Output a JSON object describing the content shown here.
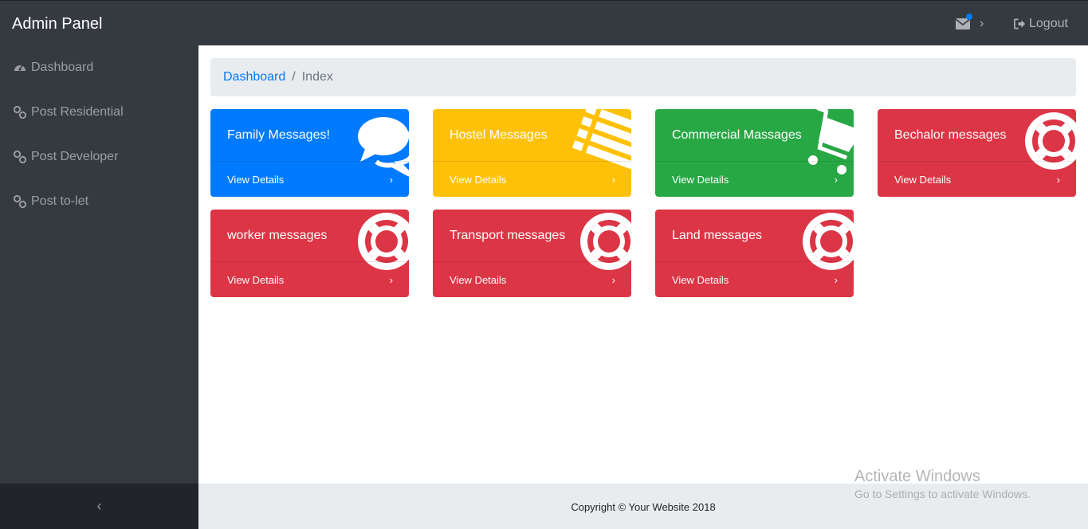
{
  "navbar": {
    "brand": "Admin Panel",
    "mail_icon": "envelope-icon",
    "logout_label": "Logout",
    "logout_icon": "sign-out-icon"
  },
  "sidebar": {
    "items": [
      {
        "label": "Dashboard",
        "icon": "tachometer-icon"
      },
      {
        "label": "Post Residential",
        "icon": "link-icon"
      },
      {
        "label": "Post Developer",
        "icon": "link-icon"
      },
      {
        "label": "Post to-let",
        "icon": "link-icon"
      }
    ],
    "toggle_icon": "chevron-left-icon"
  },
  "breadcrumb": {
    "link": "Dashboard",
    "separator": "/",
    "current": "Index"
  },
  "cards": [
    {
      "title": "Family Messages!",
      "action": "View Details",
      "color": "#007bff",
      "icon": "comments-icon"
    },
    {
      "title": "Hostel Messages",
      "action": "View Details",
      "color": "#ffc107",
      "icon": "list-icon"
    },
    {
      "title": "Commercial Massages",
      "action": "View Details",
      "color": "#28a745",
      "icon": "shopping-cart-icon"
    },
    {
      "title": "Bechalor messages",
      "action": "View Details",
      "color": "#dc3545",
      "icon": "life-ring-icon"
    },
    {
      "title": "worker messages",
      "action": "View Details",
      "color": "#dc3545",
      "icon": "life-ring-icon"
    },
    {
      "title": "Transport messages",
      "action": "View Details",
      "color": "#dc3545",
      "icon": "life-ring-icon"
    },
    {
      "title": "Land messages",
      "action": "View Details",
      "color": "#dc3545",
      "icon": "life-ring-icon"
    }
  ],
  "footer": {
    "copyright": "Copyright © Your Website 2018"
  },
  "watermark": {
    "line1": "Activate Windows",
    "line2": "Go to Settings to activate Windows."
  }
}
